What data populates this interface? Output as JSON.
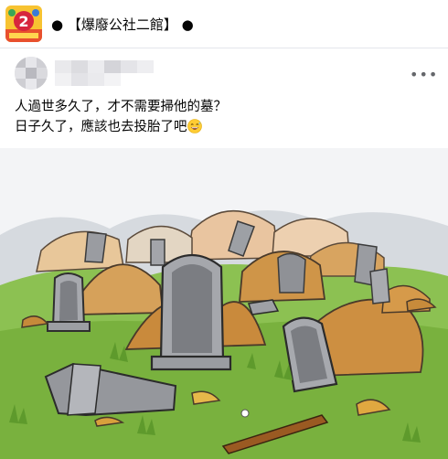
{
  "group": {
    "name_bullet_left": "●",
    "name": "【爆廢公社二館】",
    "name_bullet_right": "●",
    "logo_icon": "group-logo-icon"
  },
  "author": {
    "name": "",
    "avatar_icon": "blurred-avatar-icon"
  },
  "post": {
    "more_icon": "•••",
    "line1": "人過世多久了，才不需要掃他的墓？",
    "line2": "日子久了，應該也去投胎了吧",
    "emoji": "grinning-sweat-emoji"
  },
  "image": {
    "description_icon": "cartoon-graveyard-illustration"
  },
  "colors": {
    "text": "#050505",
    "secondary": "#65676b",
    "border": "#e4e6eb",
    "grass": "#7cb342",
    "stone": "#8f9196",
    "dirt": "#c78a3b"
  }
}
